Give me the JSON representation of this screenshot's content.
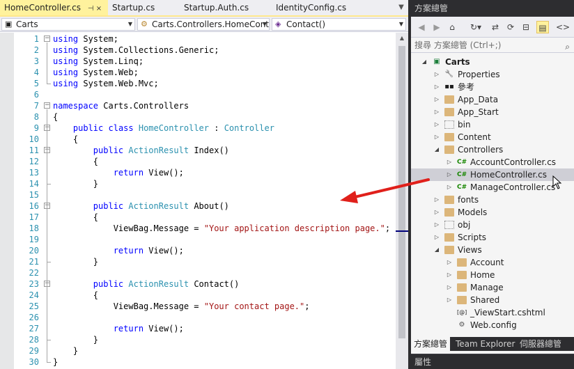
{
  "editor": {
    "tabs": [
      {
        "label": "HomeController.cs",
        "pin": "⊣ ×"
      },
      {
        "label": "Startup.cs"
      },
      {
        "label": "Startup.Auth.cs"
      },
      {
        "label": "IdentityConfig.cs"
      }
    ],
    "nav": {
      "project": "Carts",
      "class": "Carts.Controllers.HomeCont",
      "member": "Contact()"
    },
    "lines": [
      {
        "n": "1",
        "tokens": [
          [
            "kw",
            "using"
          ],
          [
            "",
            " System;"
          ]
        ]
      },
      {
        "n": "2",
        "tokens": [
          [
            "kw",
            "using"
          ],
          [
            "",
            " System.Collections.Generic;"
          ]
        ]
      },
      {
        "n": "3",
        "tokens": [
          [
            "kw",
            "using"
          ],
          [
            "",
            " System.Linq;"
          ]
        ]
      },
      {
        "n": "4",
        "tokens": [
          [
            "kw",
            "using"
          ],
          [
            "",
            " System.Web;"
          ]
        ]
      },
      {
        "n": "5",
        "tokens": [
          [
            "kw",
            "using"
          ],
          [
            "",
            " System.Web.Mvc;"
          ]
        ]
      },
      {
        "n": "6",
        "tokens": []
      },
      {
        "n": "7",
        "tokens": [
          [
            "kw",
            "namespace"
          ],
          [
            "",
            " Carts.Controllers"
          ]
        ]
      },
      {
        "n": "8",
        "tokens": [
          [
            "",
            "{"
          ]
        ]
      },
      {
        "n": "9",
        "tokens": [
          [
            "",
            "    "
          ],
          [
            "kw",
            "public"
          ],
          [
            "",
            " "
          ],
          [
            "kw",
            "class"
          ],
          [
            "",
            " "
          ],
          [
            "ty",
            "HomeController"
          ],
          [
            "",
            " : "
          ],
          [
            "ty",
            "Controller"
          ]
        ]
      },
      {
        "n": "10",
        "tokens": [
          [
            "",
            "    {"
          ]
        ]
      },
      {
        "n": "11",
        "tokens": [
          [
            "",
            "        "
          ],
          [
            "kw",
            "public"
          ],
          [
            "",
            " "
          ],
          [
            "ty",
            "ActionResult"
          ],
          [
            "",
            " Index()"
          ]
        ]
      },
      {
        "n": "12",
        "tokens": [
          [
            "",
            "        {"
          ]
        ]
      },
      {
        "n": "13",
        "tokens": [
          [
            "",
            "            "
          ],
          [
            "kw",
            "return"
          ],
          [
            "",
            " View();"
          ]
        ]
      },
      {
        "n": "14",
        "tokens": [
          [
            "",
            "        }"
          ]
        ]
      },
      {
        "n": "15",
        "tokens": []
      },
      {
        "n": "16",
        "tokens": [
          [
            "",
            "        "
          ],
          [
            "kw",
            "public"
          ],
          [
            "",
            " "
          ],
          [
            "ty",
            "ActionResult"
          ],
          [
            "",
            " About()"
          ]
        ]
      },
      {
        "n": "17",
        "tokens": [
          [
            "",
            "        {"
          ]
        ]
      },
      {
        "n": "18",
        "tokens": [
          [
            "",
            "            ViewBag.Message = "
          ],
          [
            "st",
            "\"Your application description page.\""
          ],
          [
            "",
            ";"
          ]
        ]
      },
      {
        "n": "19",
        "tokens": []
      },
      {
        "n": "20",
        "tokens": [
          [
            "",
            "            "
          ],
          [
            "kw",
            "return"
          ],
          [
            "",
            " View();"
          ]
        ]
      },
      {
        "n": "21",
        "tokens": [
          [
            "",
            "        }"
          ]
        ]
      },
      {
        "n": "22",
        "tokens": []
      },
      {
        "n": "23",
        "tokens": [
          [
            "",
            "        "
          ],
          [
            "kw",
            "public"
          ],
          [
            "",
            " "
          ],
          [
            "ty",
            "ActionResult"
          ],
          [
            "",
            " Contact()"
          ]
        ]
      },
      {
        "n": "24",
        "tokens": [
          [
            "",
            "        {"
          ]
        ]
      },
      {
        "n": "25",
        "tokens": [
          [
            "",
            "            ViewBag.Message = "
          ],
          [
            "st",
            "\"Your contact page.\""
          ],
          [
            "",
            ";"
          ]
        ]
      },
      {
        "n": "26",
        "tokens": []
      },
      {
        "n": "27",
        "tokens": [
          [
            "",
            "            "
          ],
          [
            "kw",
            "return"
          ],
          [
            "",
            " View();"
          ]
        ]
      },
      {
        "n": "28",
        "tokens": [
          [
            "",
            "        }"
          ]
        ]
      },
      {
        "n": "29",
        "tokens": [
          [
            "",
            "    }"
          ]
        ]
      },
      {
        "n": "30",
        "tokens": [
          [
            "",
            "}"
          ]
        ]
      }
    ],
    "fold_lines": [
      "1",
      "7",
      "9",
      "11",
      "16",
      "23"
    ]
  },
  "solution_explorer": {
    "title": "方案總管",
    "search_placeholder": "搜尋 方案總管 (Ctrl+;)",
    "toolbar_icons": [
      "back-icon",
      "forward-icon",
      "home-icon",
      "history-icon",
      "sync-icon",
      "refresh-icon",
      "collapse-icon",
      "show-all-files-icon",
      "code-icon"
    ],
    "tree": [
      {
        "label": "Carts",
        "level": 0,
        "expander": "open",
        "icon": "project",
        "bold": true
      },
      {
        "label": "Properties",
        "level": 1,
        "expander": "closed",
        "icon": "wrench"
      },
      {
        "label": "參考",
        "level": 1,
        "expander": "closed",
        "icon": "references"
      },
      {
        "label": "App_Data",
        "level": 1,
        "expander": "closed",
        "icon": "folder"
      },
      {
        "label": "App_Start",
        "level": 1,
        "expander": "closed",
        "icon": "folder"
      },
      {
        "label": "bin",
        "level": 1,
        "expander": "closed",
        "icon": "folder-dotted"
      },
      {
        "label": "Content",
        "level": 1,
        "expander": "closed",
        "icon": "folder"
      },
      {
        "label": "Controllers",
        "level": 1,
        "expander": "open",
        "icon": "folder"
      },
      {
        "label": "AccountController.cs",
        "level": 2,
        "expander": "closed",
        "icon": "cs"
      },
      {
        "label": "HomeController.cs",
        "level": 2,
        "expander": "closed",
        "icon": "cs",
        "selected": true
      },
      {
        "label": "ManageController.cs",
        "level": 2,
        "expander": "closed",
        "icon": "cs"
      },
      {
        "label": "fonts",
        "level": 1,
        "expander": "closed",
        "icon": "folder"
      },
      {
        "label": "Models",
        "level": 1,
        "expander": "closed",
        "icon": "folder"
      },
      {
        "label": "obj",
        "level": 1,
        "expander": "closed",
        "icon": "folder-dotted"
      },
      {
        "label": "Scripts",
        "level": 1,
        "expander": "closed",
        "icon": "folder"
      },
      {
        "label": "Views",
        "level": 1,
        "expander": "open",
        "icon": "folder"
      },
      {
        "label": "Account",
        "level": 2,
        "expander": "closed",
        "icon": "folder"
      },
      {
        "label": "Home",
        "level": 2,
        "expander": "closed",
        "icon": "folder"
      },
      {
        "label": "Manage",
        "level": 2,
        "expander": "closed",
        "icon": "folder"
      },
      {
        "label": "Shared",
        "level": 2,
        "expander": "closed",
        "icon": "folder"
      },
      {
        "label": "_ViewStart.cshtml",
        "level": 2,
        "expander": "none",
        "icon": "cshtml"
      },
      {
        "label": "Web.config",
        "level": 2,
        "expander": "none",
        "icon": "config"
      }
    ],
    "bottom_tabs": [
      "方案總管",
      "Team Explorer",
      "伺服器總管"
    ],
    "properties_title": "屬性"
  },
  "colors": {
    "keyword": "#0000ff",
    "type": "#2b91af",
    "string": "#a31515",
    "active_tab": "#fff29d",
    "annotation_arrow": "#e0201b"
  }
}
